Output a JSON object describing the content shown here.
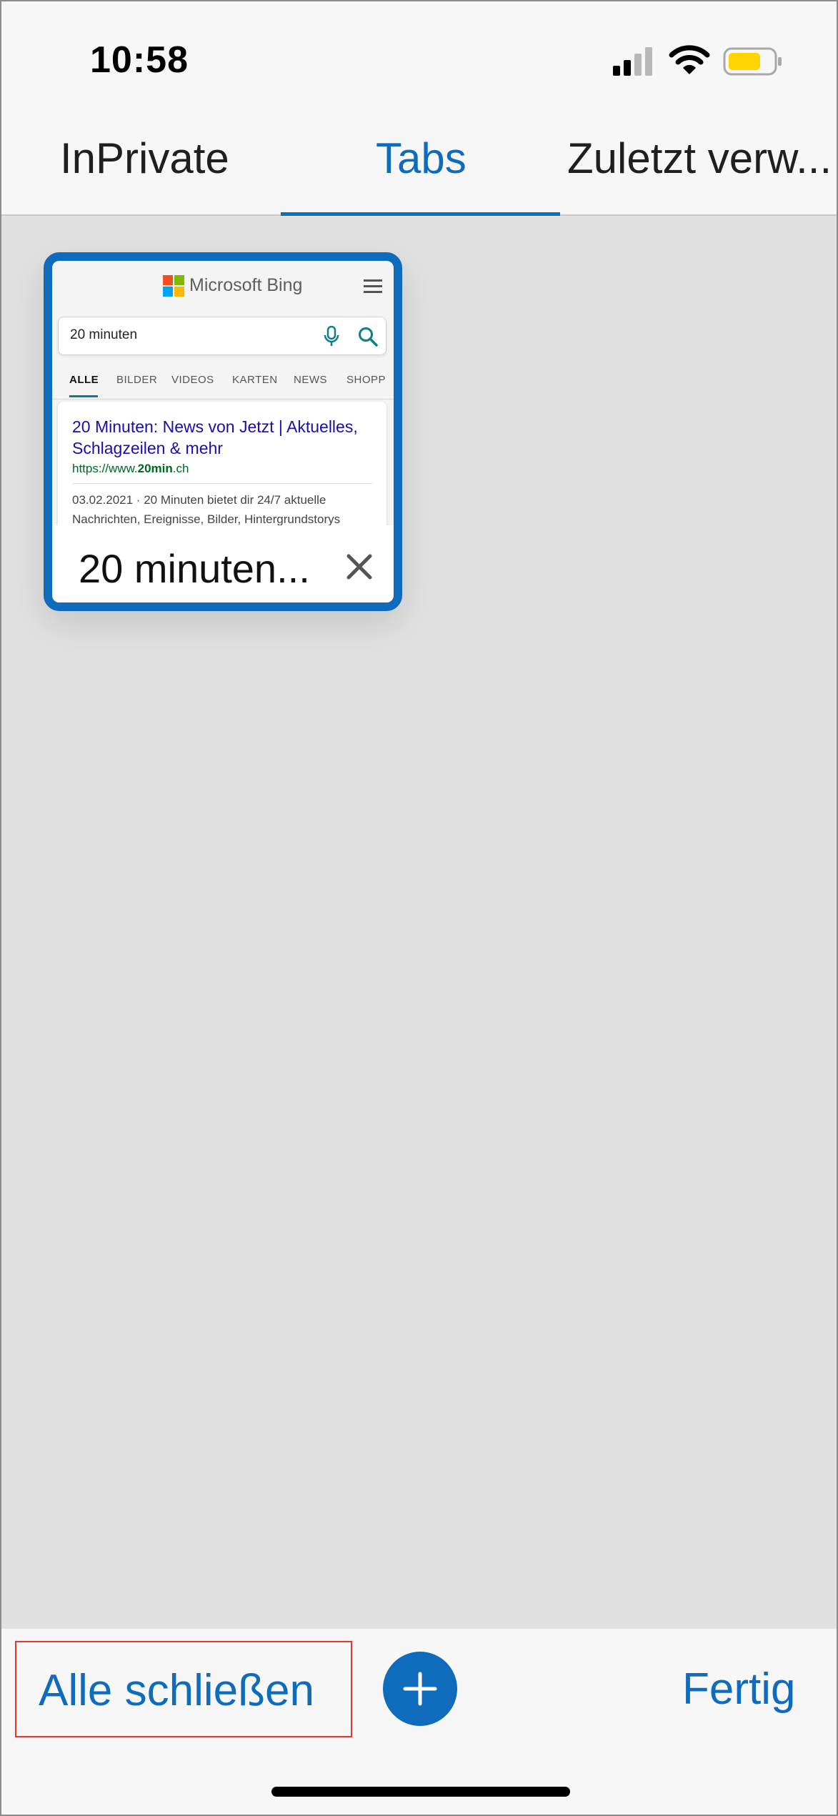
{
  "status_bar": {
    "time": "10:58",
    "icons": [
      "signal-icon",
      "wifi-icon",
      "battery-icon"
    ]
  },
  "tabs_header": {
    "items": [
      {
        "label": "InPrivate",
        "active": false
      },
      {
        "label": "Tabs",
        "active": true
      },
      {
        "label": "Zuletzt verw..."
      }
    ]
  },
  "tab_card": {
    "title": "20 minuten...",
    "preview": {
      "brand": "Microsoft Bing",
      "search_query": "20 minuten",
      "nav": [
        "ALLE",
        "BILDER",
        "VIDEOS",
        "KARTEN",
        "NEWS",
        "SHOPP"
      ],
      "result": {
        "title": "20 Minuten: News von Jetzt | Aktuelles, Schlagzeilen & mehr",
        "url_prefix": "https://www.",
        "url_bold": "20min",
        "url_suffix": ".ch",
        "snippet": "03.02.2021 · 20 Minuten bietet dir 24/7 aktuelle Nachrichten, Ereignisse, Bilder, Hintergrundstorys"
      }
    }
  },
  "toolbar": {
    "close_all_label": "Alle schließen",
    "done_label": "Fertig"
  },
  "colors": {
    "accent": "#0f6cbd",
    "highlight_border": "#e0392e",
    "background": "#e1e1e1",
    "battery": "#ffd400"
  }
}
